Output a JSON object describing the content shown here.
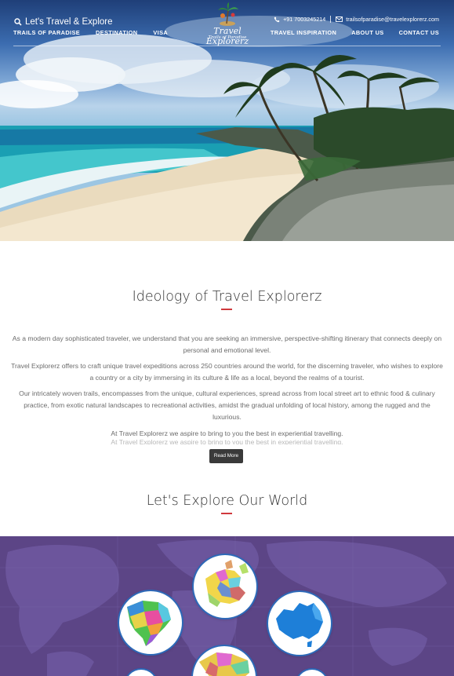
{
  "header": {
    "search_label": "Let's Travel & Explore",
    "nav_left": [
      "TRAILS OF PARADISE",
      "DESTINATION",
      "VISA"
    ],
    "nav_right": [
      "TRAVEL INSPIRATION",
      "ABOUT US",
      "CONTACT US"
    ],
    "phone": "+91 7003245214",
    "email": "trailsofparadise@travelexplorerz.com",
    "logo": {
      "brand": "Travel Explorerz",
      "tagline": "Trails of Paradise"
    },
    "icons": {
      "search": "search-icon",
      "phone": "phone-icon",
      "email": "envelope-icon"
    }
  },
  "ideology": {
    "title": "Ideology of Travel Explorerz",
    "paragraphs": [
      "As a modern day sophisticated traveler, we understand that you are seeking an immersive, perspective-shifting itinerary that connects deeply on personal and emotional level.",
      "Travel Explorerz offers to craft unique travel expeditions across 250 countries around the world, for the discerning traveler, who wishes to explore a country or a city by immersing in its culture & life as a local, beyond the realms of a tourist.",
      "Our intricately woven trails, encompasses from the unique, cultural experiences, spread across from local street art to ethnic food & culinary practice, from exotic natural landscapes to recreational activities, amidst the gradual unfolding of local history, among the rugged and the luxurious.",
      "At Travel Explorerz we aspire to bring to you the best in experiential travelling."
    ],
    "ghost_line": "At Travel Explorerz we aspire to bring to you the best in experiential travelling.",
    "read_more": "Read More"
  },
  "explore": {
    "title": "Let's Explore Our World",
    "regions": [
      "europe-map",
      "north-america-map",
      "australia-map",
      "asia-map"
    ]
  },
  "colors": {
    "accent": "#d0383c",
    "map_bg": "#5c4586",
    "button": "#3a3a3a",
    "circle_ring": "#2d69b8"
  }
}
